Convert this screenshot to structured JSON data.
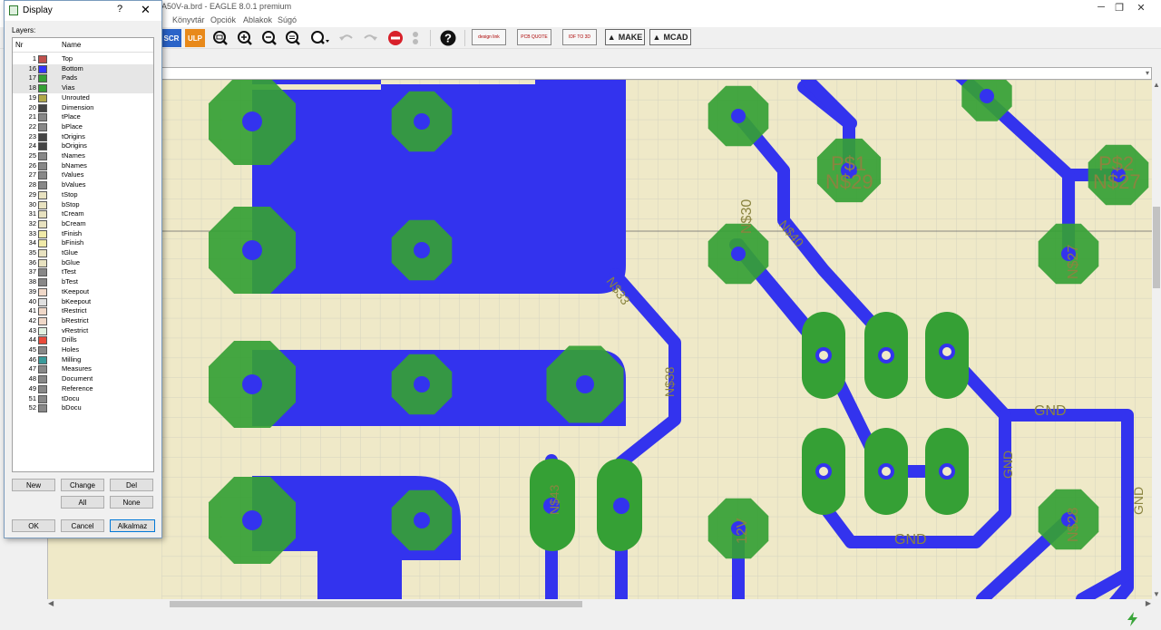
{
  "window": {
    "title": "A50V-a.brd - EAGLE 8.0.1 premium"
  },
  "menu": [
    "Könyvtár",
    "Opciók",
    "Ablakok",
    "Súgó"
  ],
  "toolbar": {
    "scr_label": "SCR",
    "ulp_label": "ULP",
    "design_link": "design link",
    "pcb_quote": "PCB QUOTE",
    "idf": "IDF TO 3D",
    "make": "MAKE",
    "mcad": "MCAD"
  },
  "dialog": {
    "title": "Display",
    "help": "?",
    "close": "✕",
    "layers_label": "Layers:",
    "col_nr": "Nr",
    "col_name": "Name",
    "layers": [
      {
        "nr": "1",
        "name": "Top",
        "color": "#c0504d",
        "sel": false
      },
      {
        "nr": "16",
        "name": "Bottom",
        "color": "#3333ff",
        "sel": true
      },
      {
        "nr": "17",
        "name": "Pads",
        "color": "#35a035",
        "sel": true
      },
      {
        "nr": "18",
        "name": "Vias",
        "color": "#35a035",
        "sel": true
      },
      {
        "nr": "19",
        "name": "Unrouted",
        "color": "#b0a848",
        "sel": false
      },
      {
        "nr": "20",
        "name": "Dimension",
        "color": "#444444",
        "sel": false
      },
      {
        "nr": "21",
        "name": "tPlace",
        "color": "#888888",
        "sel": false
      },
      {
        "nr": "22",
        "name": "bPlace",
        "color": "#888888",
        "sel": false
      },
      {
        "nr": "23",
        "name": "tOrigins",
        "color": "#444444",
        "sel": false
      },
      {
        "nr": "24",
        "name": "bOrigins",
        "color": "#444444",
        "sel": false
      },
      {
        "nr": "25",
        "name": "tNames",
        "color": "#888888",
        "sel": false
      },
      {
        "nr": "26",
        "name": "bNames",
        "color": "#888888",
        "sel": false
      },
      {
        "nr": "27",
        "name": "tValues",
        "color": "#888888",
        "sel": false
      },
      {
        "nr": "28",
        "name": "bValues",
        "color": "#888888",
        "sel": false
      },
      {
        "nr": "29",
        "name": "tStop",
        "color": "#e8e2c0",
        "sel": false
      },
      {
        "nr": "30",
        "name": "bStop",
        "color": "#e8e2c0",
        "sel": false
      },
      {
        "nr": "31",
        "name": "tCream",
        "color": "#e8e2c0",
        "sel": false
      },
      {
        "nr": "32",
        "name": "bCream",
        "color": "#e8e2c0",
        "sel": false
      },
      {
        "nr": "33",
        "name": "tFinish",
        "color": "#f0eaa8",
        "sel": false
      },
      {
        "nr": "34",
        "name": "bFinish",
        "color": "#f0eaa8",
        "sel": false
      },
      {
        "nr": "35",
        "name": "tGlue",
        "color": "#e8e2c0",
        "sel": false
      },
      {
        "nr": "36",
        "name": "bGlue",
        "color": "#e8e2c0",
        "sel": false
      },
      {
        "nr": "37",
        "name": "tTest",
        "color": "#888888",
        "sel": false
      },
      {
        "nr": "38",
        "name": "bTest",
        "color": "#888888",
        "sel": false
      },
      {
        "nr": "39",
        "name": "tKeepout",
        "color": "#f0d8c8",
        "sel": false
      },
      {
        "nr": "40",
        "name": "bKeepout",
        "color": "#e0e0e0",
        "sel": false
      },
      {
        "nr": "41",
        "name": "tRestrict",
        "color": "#f0d8c8",
        "sel": false
      },
      {
        "nr": "42",
        "name": "bRestrict",
        "color": "#f0d8c8",
        "sel": false
      },
      {
        "nr": "43",
        "name": "vRestrict",
        "color": "#e0f0e0",
        "sel": false
      },
      {
        "nr": "44",
        "name": "Drills",
        "color": "#e84a3a",
        "sel": false
      },
      {
        "nr": "45",
        "name": "Holes",
        "color": "#888888",
        "sel": false
      },
      {
        "nr": "46",
        "name": "Milling",
        "color": "#3a9a9a",
        "sel": false
      },
      {
        "nr": "47",
        "name": "Measures",
        "color": "#888888",
        "sel": false
      },
      {
        "nr": "48",
        "name": "Document",
        "color": "#888888",
        "sel": false
      },
      {
        "nr": "49",
        "name": "Reference",
        "color": "#888888",
        "sel": false
      },
      {
        "nr": "51",
        "name": "tDocu",
        "color": "#888888",
        "sel": false
      },
      {
        "nr": "52",
        "name": "bDocu",
        "color": "#888888",
        "sel": false
      }
    ],
    "buttons": {
      "new": "New",
      "change": "Change",
      "del": "Del",
      "all": "All",
      "none": "None",
      "ok": "OK",
      "cancel": "Cancel",
      "apply": "Alkalmaz"
    }
  },
  "board_labels": {
    "ns29": "N$29",
    "p1": "P$1",
    "ns27": "N$27",
    "p2": "P$2",
    "ns30": "N$30",
    "ns40": "N$40",
    "ns38": "N$38",
    "ns43": "N$43",
    "ns28": "N$28",
    "v12": "12V",
    "gnd": "GND",
    "ns33": "N$33"
  },
  "colors": {
    "board_bg": "#efe9c8",
    "copper_bottom": "#3333ee",
    "pad": "#35a035",
    "grid": "#d4d4c0"
  }
}
